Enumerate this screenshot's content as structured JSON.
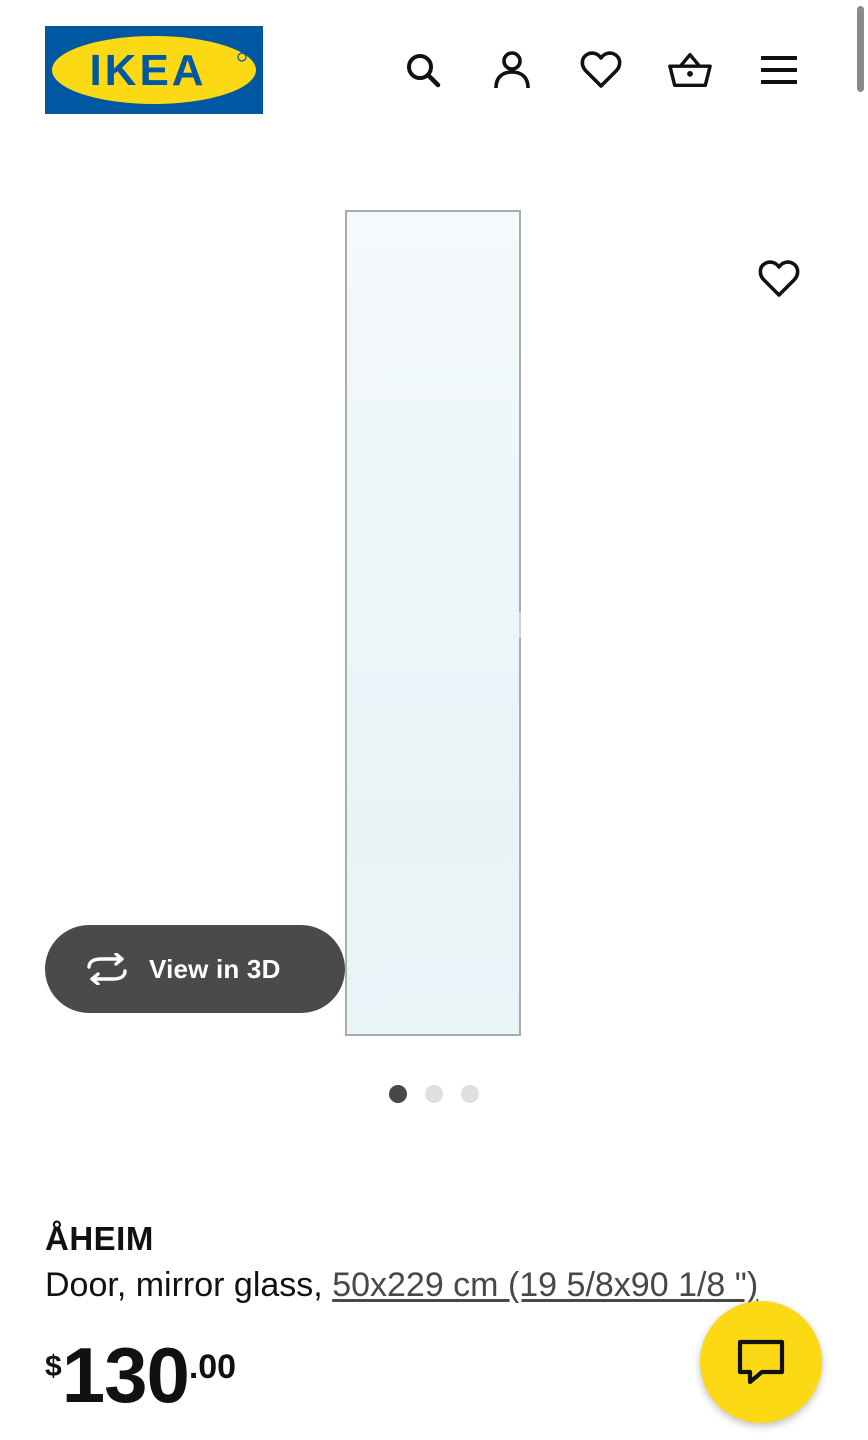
{
  "header": {
    "logo_text": "IKEA",
    "icons": [
      "search-icon",
      "account-icon",
      "heart-icon",
      "basket-icon",
      "menu-icon"
    ]
  },
  "gallery": {
    "view3d_label": "View in 3D",
    "dots_count": 3,
    "active_dot": 0
  },
  "product": {
    "name": "ÅHEIM",
    "description": "Door, mirror glass, ",
    "dimensions": "50x229 cm (19 5/8x90 1/8 \")",
    "price": {
      "currency": "$",
      "integer": "130",
      "decimal": ".00"
    }
  },
  "colors": {
    "brand_blue": "#0058a3",
    "brand_yellow": "#fbd914",
    "button_dark": "#4a4a4a"
  }
}
